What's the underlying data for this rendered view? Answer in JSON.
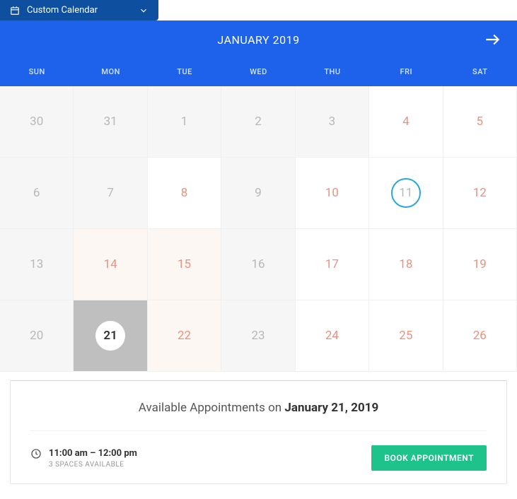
{
  "dropdown": {
    "label": "Custom Calendar"
  },
  "month": {
    "title": "JANUARY 2019"
  },
  "dow": [
    "SUN",
    "MON",
    "TUE",
    "WED",
    "THU",
    "FRI",
    "SAT"
  ],
  "days": [
    {
      "n": "30",
      "cls": "dim"
    },
    {
      "n": "31",
      "cls": "dim"
    },
    {
      "n": "1",
      "cls": "dim"
    },
    {
      "n": "2",
      "cls": "dim"
    },
    {
      "n": "3",
      "cls": "dim"
    },
    {
      "n": "4",
      "cls": "avail white"
    },
    {
      "n": "5",
      "cls": "avail white"
    },
    {
      "n": "6",
      "cls": "dim"
    },
    {
      "n": "7",
      "cls": "dim"
    },
    {
      "n": "8",
      "cls": "avail white"
    },
    {
      "n": "9",
      "cls": "dim"
    },
    {
      "n": "10",
      "cls": "avail white"
    },
    {
      "n": "11",
      "cls": "white today-circle"
    },
    {
      "n": "12",
      "cls": "avail white"
    },
    {
      "n": "13",
      "cls": "dim"
    },
    {
      "n": "14",
      "cls": "avail"
    },
    {
      "n": "15",
      "cls": "avail"
    },
    {
      "n": "16",
      "cls": "dim"
    },
    {
      "n": "17",
      "cls": "avail white"
    },
    {
      "n": "18",
      "cls": "avail white"
    },
    {
      "n": "19",
      "cls": "avail white"
    },
    {
      "n": "20",
      "cls": "dim"
    },
    {
      "n": "21",
      "cls": "selected"
    },
    {
      "n": "22",
      "cls": "avail"
    },
    {
      "n": "23",
      "cls": "dim"
    },
    {
      "n": "24",
      "cls": "avail white"
    },
    {
      "n": "25",
      "cls": "avail white"
    },
    {
      "n": "26",
      "cls": "avail white"
    }
  ],
  "appointments": {
    "title_prefix": "Available Appointments on ",
    "title_date": "January 21, 2019",
    "slot": {
      "time": "11:00 am – 12:00 pm",
      "avail": "3 SPACES AVAILABLE",
      "button": "BOOK APPOINTMENT"
    }
  }
}
